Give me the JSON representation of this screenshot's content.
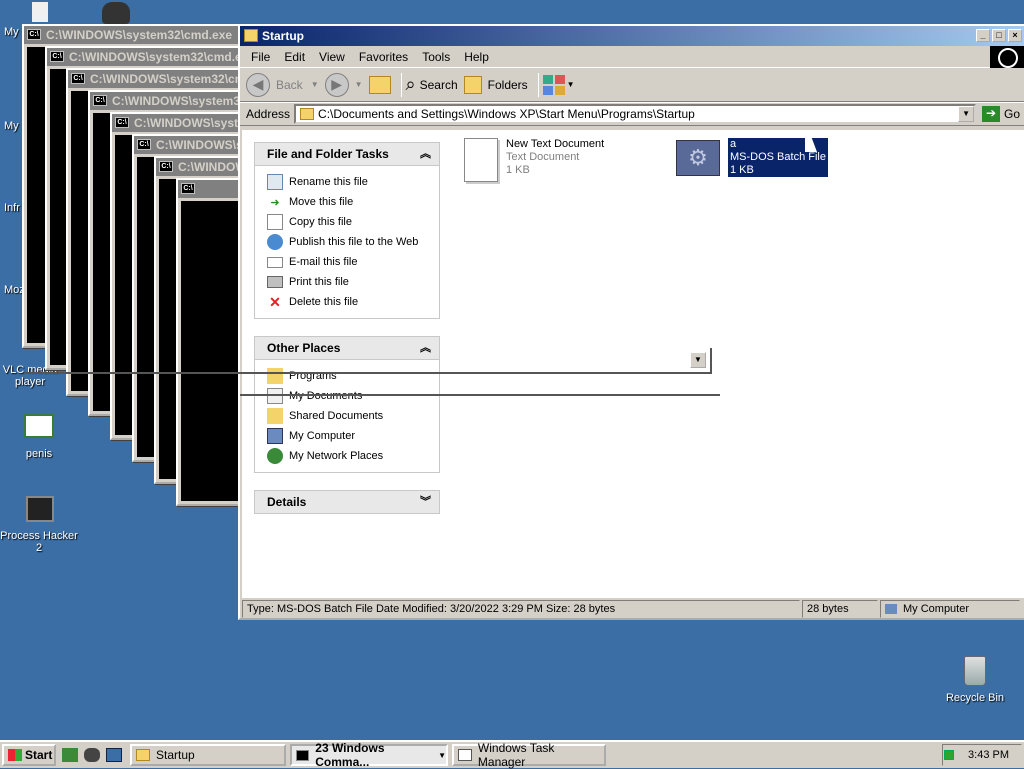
{
  "desktop": {
    "icons": [
      {
        "label": "My",
        "icon": "my-documents-icon"
      },
      {
        "label": "My",
        "icon": "my-computer-icon"
      },
      {
        "label": "Infr",
        "icon": "infrared-icon"
      },
      {
        "label": "Moz",
        "icon": "mozilla-icon"
      },
      {
        "label": "VLC media player",
        "icon": "vlc-icon"
      },
      {
        "label": "penis",
        "icon": "certificate-icon"
      },
      {
        "label": "Process Hacker 2",
        "icon": "process-hacker-icon"
      },
      {
        "label": "Recycle Bin",
        "icon": "recycle-bin-icon"
      }
    ]
  },
  "cmd_windows": [
    {
      "title": "C:\\WINDOWS\\system32\\cmd.exe"
    },
    {
      "title": "C:\\WINDOWS\\system32\\cmd.exe"
    },
    {
      "title": "C:\\WINDOWS\\system32\\cmd.exe"
    },
    {
      "title": "C:\\WINDOWS\\system32\\cmd.exe"
    },
    {
      "title": "C:\\WINDOWS\\system32\\cmd.exe"
    },
    {
      "title": "C:\\WINDOWS\\system32\\cmd.exe"
    },
    {
      "title": "C:\\WINDOWS\\system32\\cmd.exe"
    },
    {
      "title": ""
    }
  ],
  "cmd_icon_text": "C:\\",
  "explorer": {
    "title": "Startup",
    "menu": [
      "File",
      "Edit",
      "View",
      "Favorites",
      "Tools",
      "Help"
    ],
    "toolbar": {
      "back": "Back",
      "search": "Search",
      "folders": "Folders"
    },
    "address": {
      "label": "Address",
      "value": "C:\\Documents and Settings\\Windows XP\\Start Menu\\Programs\\Startup",
      "go": "Go"
    },
    "tasks": {
      "title": "File and Folder Tasks",
      "items": [
        "Rename this file",
        "Move this file",
        "Copy this file",
        "Publish this file to the Web",
        "E-mail this file",
        "Print this file",
        "Delete this file"
      ]
    },
    "other_places": {
      "title": "Other Places",
      "items": [
        "Programs",
        "My Documents",
        "Shared Documents",
        "My Computer",
        "My Network Places"
      ]
    },
    "details": {
      "title": "Details"
    },
    "files": [
      {
        "name": "New Text Document",
        "type": "Text Document",
        "size": "1 KB",
        "selected": false
      },
      {
        "name": "a",
        "type": "MS-DOS Batch File",
        "size": "1 KB",
        "selected": true
      }
    ],
    "status": {
      "info": "Type: MS-DOS Batch File Date Modified: 3/20/2022 3:29 PM Size: 28 bytes",
      "size": "28 bytes",
      "location": "My Computer"
    }
  },
  "taskbar": {
    "start": "Start",
    "tasks": [
      {
        "label": "Startup",
        "active": false
      },
      {
        "label": "23 Windows Comma...",
        "active": true
      },
      {
        "label": "Windows Task Manager",
        "active": false
      }
    ],
    "clock": "3:43 PM"
  }
}
